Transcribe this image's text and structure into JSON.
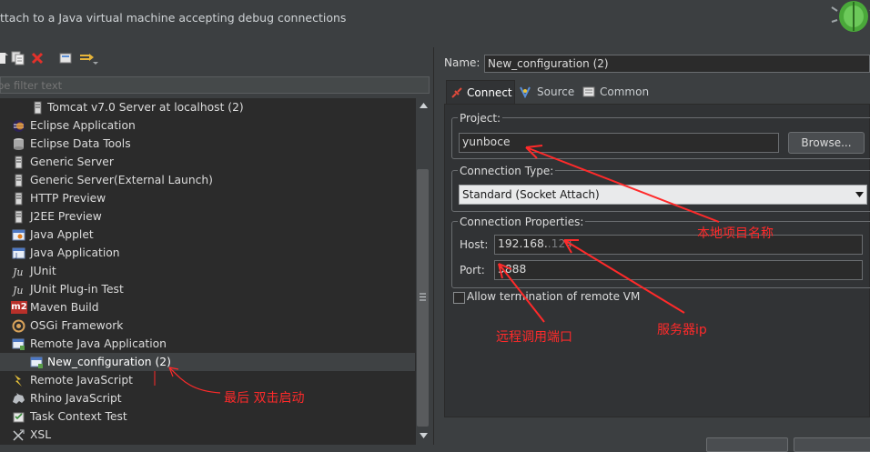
{
  "header": {
    "title_partial": "/ ,    ",
    "subtitle": "ttach to a Java virtual machine accepting debug connections"
  },
  "filter": {
    "placeholder": "pe filter text"
  },
  "tree": {
    "items": [
      {
        "label": "Tomcat v7.0 Server at localhost (2)",
        "icon": "server-icon"
      },
      {
        "label": "Eclipse Application",
        "icon": "eclipse-icon"
      },
      {
        "label": "Eclipse Data Tools",
        "icon": "database-icon"
      },
      {
        "label": "Generic Server",
        "icon": "server-icon"
      },
      {
        "label": "Generic Server(External Launch)",
        "icon": "server-icon"
      },
      {
        "label": "HTTP Preview",
        "icon": "server-icon"
      },
      {
        "label": "J2EE Preview",
        "icon": "server-icon"
      },
      {
        "label": "Java Applet",
        "icon": "applet-icon"
      },
      {
        "label": "Java Application",
        "icon": "java-app-icon"
      },
      {
        "label": "JUnit",
        "icon": "junit-icon"
      },
      {
        "label": "JUnit Plug-in Test",
        "icon": "junit-icon"
      },
      {
        "label": "Maven Build",
        "icon": "maven-icon",
        "badge": "m2"
      },
      {
        "label": "OSGi Framework",
        "icon": "osgi-icon"
      },
      {
        "label": "Remote Java Application",
        "icon": "remote-java-icon"
      },
      {
        "label": "New_configuration (2)",
        "icon": "remote-java-icon",
        "selected": true
      },
      {
        "label": "Remote JavaScript",
        "icon": "remote-js-icon"
      },
      {
        "label": "Rhino JavaScript",
        "icon": "rhino-icon"
      },
      {
        "label": "Task Context Test",
        "icon": "task-icon"
      },
      {
        "label": "XSL",
        "icon": "xsl-icon"
      }
    ]
  },
  "form": {
    "name_label": "Name:",
    "name_value": "New_configuration (2)",
    "tabs": [
      {
        "label": "Connect",
        "active": true
      },
      {
        "label": "Source",
        "active": false
      },
      {
        "label": "Common",
        "active": false
      }
    ],
    "project_group": "Project:",
    "project_value": "yunboce",
    "browse_label": "Browse...",
    "conn_type_group": "Connection Type:",
    "conn_type_value": "Standard (Socket Attach)",
    "conn_props_group": "Connection Properties:",
    "host_label": "Host:",
    "host_value": "192.168.",
    "host_tail": ".124",
    "port_label": "Port:",
    "port_value": "5888",
    "allow_term_label": "Allow termination of remote VM"
  },
  "annotations": {
    "project_name": "本地项目名称",
    "server_ip": "服务器ip",
    "remote_port": "远程调用端口",
    "double_click": "最后 双击启动"
  },
  "colors": {
    "background": "#3c3f41",
    "tree_bg": "#2b2b2b",
    "annotation": "#ff2a2a",
    "selected_row": "#3f4244"
  }
}
